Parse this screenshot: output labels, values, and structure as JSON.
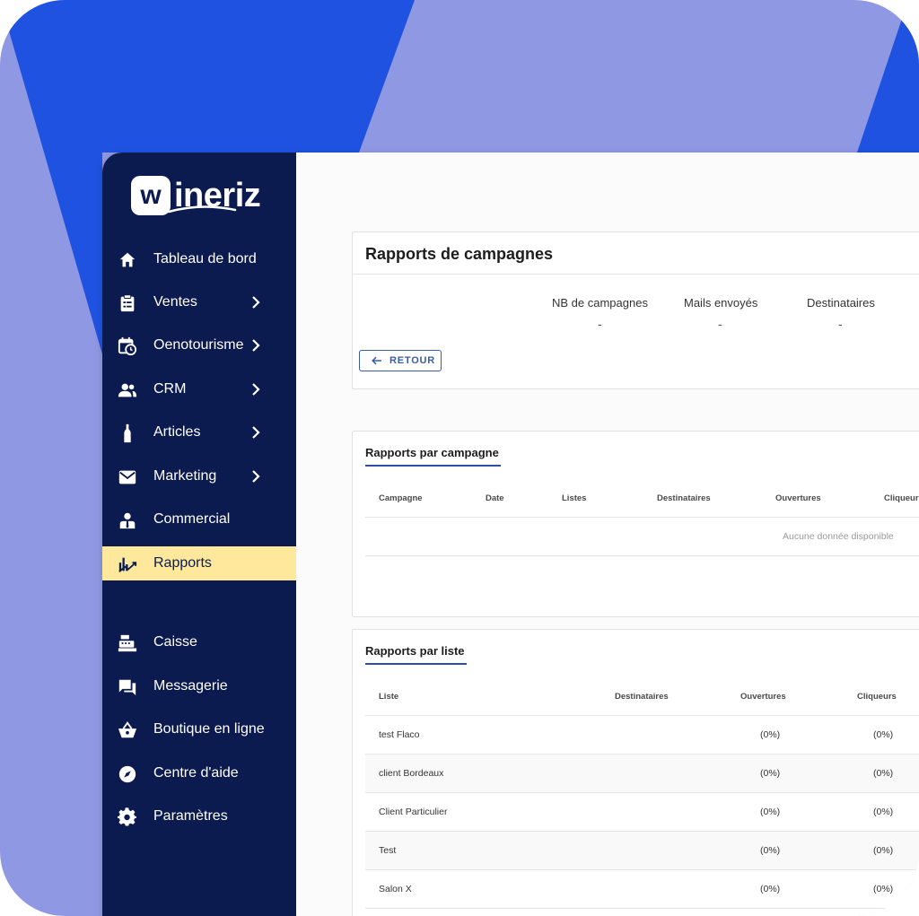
{
  "brand": {
    "logo_letter": "w",
    "logo_rest": "ineriz"
  },
  "sidebar": {
    "items": [
      {
        "label": "Tableau de bord",
        "icon": "home-icon",
        "chevron": false
      },
      {
        "label": "Ventes",
        "icon": "clipboard-icon",
        "chevron": true
      },
      {
        "label": "Oenotourisme",
        "icon": "calendar-clock-icon",
        "chevron": true
      },
      {
        "label": "CRM",
        "icon": "people-icon",
        "chevron": true
      },
      {
        "label": "Articles",
        "icon": "bottle-icon",
        "chevron": true
      },
      {
        "label": "Marketing",
        "icon": "mail-icon",
        "chevron": true
      },
      {
        "label": "Commercial",
        "icon": "salesperson-icon",
        "chevron": false
      },
      {
        "label": "Rapports",
        "icon": "chart-icon",
        "chevron": false,
        "active": true
      },
      {
        "label": "Caisse",
        "icon": "cash-register-icon",
        "chevron": false
      },
      {
        "label": "Messagerie",
        "icon": "chat-icon",
        "chevron": false
      },
      {
        "label": "Boutique en ligne",
        "icon": "basket-icon",
        "chevron": false
      },
      {
        "label": "Centre d'aide",
        "icon": "compass-icon",
        "chevron": false
      },
      {
        "label": "Paramètres",
        "icon": "gear-icon",
        "chevron": false
      }
    ]
  },
  "report": {
    "title": "Rapports de campagnes",
    "stats": [
      {
        "label": "NB de campagnes",
        "value": "-"
      },
      {
        "label": "Mails envoyés",
        "value": "-"
      },
      {
        "label": "Destinataires",
        "value": "-"
      }
    ],
    "back_label": "RETOUR"
  },
  "by_campaign": {
    "title": "Rapports par campagne",
    "columns": [
      "Campagne",
      "Date",
      "Listes",
      "Destinataires",
      "Ouvertures",
      "Cliqueurs"
    ],
    "empty": "Aucune donnée disponible"
  },
  "by_list": {
    "title": "Rapports par liste",
    "columns": [
      "Liste",
      "Destinataires",
      "Ouvertures",
      "Cliqueurs"
    ],
    "rows": [
      {
        "name": "test Flaco",
        "opens": "(0%)",
        "clicks": "(0%)"
      },
      {
        "name": "client Bordeaux",
        "opens": "(0%)",
        "clicks": "(0%)"
      },
      {
        "name": "Client Particulier",
        "opens": "(0%)",
        "clicks": "(0%)"
      },
      {
        "name": "Test",
        "opens": "(0%)",
        "clicks": "(0%)"
      },
      {
        "name": "Salon X",
        "opens": "(0%)",
        "clicks": "(0%)"
      }
    ]
  },
  "colors": {
    "sidebar": "#0c1b4f",
    "active": "#fde89c",
    "accent": "#2c4fa5",
    "bg_blue": "#1f52e0",
    "bg_lavender": "#8f98e2"
  }
}
